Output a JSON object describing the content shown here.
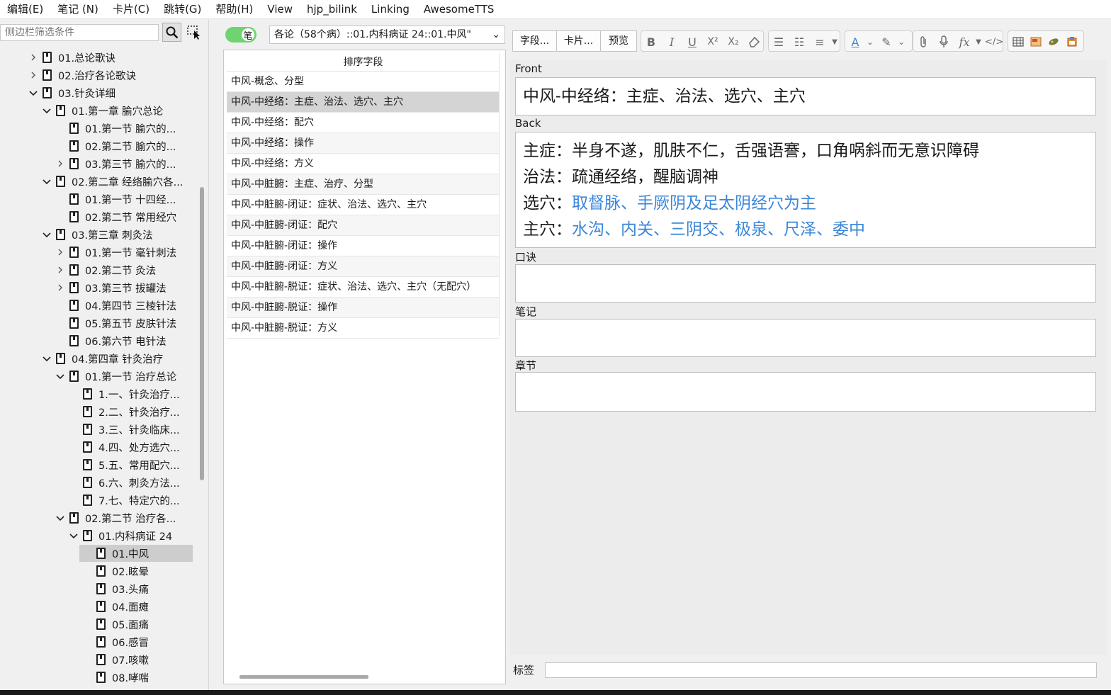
{
  "menu": [
    "编辑(E)",
    "笔记 (N)",
    "卡片(C)",
    "跳转(G)",
    "帮助(H)",
    "View",
    "hjp_bilink",
    "Linking",
    "AwesomeTTS"
  ],
  "sidebar": {
    "search_placeholder": "侧边栏筛选条件",
    "tree": [
      {
        "label": "01.总论歌诀",
        "chevron": "right",
        "level": 0
      },
      {
        "label": "02.治疗各论歌诀",
        "chevron": "right",
        "level": 0
      },
      {
        "label": "03.针灸详细",
        "chevron": "down",
        "level": 0
      },
      {
        "label": "01.第一章 腧穴总论",
        "chevron": "down",
        "level": 1
      },
      {
        "label": "01.第一节 腧穴的...",
        "chevron": "",
        "level": 2
      },
      {
        "label": "02.第二节 腧穴的...",
        "chevron": "",
        "level": 2
      },
      {
        "label": "03.第三节 腧穴的...",
        "chevron": "right",
        "level": 2
      },
      {
        "label": "02.第二章 经络腧穴各...",
        "chevron": "down",
        "level": 1
      },
      {
        "label": "01.第一节 十四经...",
        "chevron": "",
        "level": 2
      },
      {
        "label": "02.第二节 常用经穴",
        "chevron": "",
        "level": 2
      },
      {
        "label": "03.第三章 刺灸法",
        "chevron": "down",
        "level": 1
      },
      {
        "label": "01.第一节 毫针刺法",
        "chevron": "right",
        "level": 2
      },
      {
        "label": "02.第二节 灸法",
        "chevron": "right",
        "level": 2
      },
      {
        "label": "03.第三节 拔罐法",
        "chevron": "right",
        "level": 2
      },
      {
        "label": "04.第四节 三棱针法",
        "chevron": "",
        "level": 2
      },
      {
        "label": "05.第五节 皮肤针法",
        "chevron": "",
        "level": 2
      },
      {
        "label": "06.第六节 电针法",
        "chevron": "",
        "level": 2
      },
      {
        "label": "04.第四章 针灸治疗",
        "chevron": "down",
        "level": 1
      },
      {
        "label": "01.第一节 治疗总论",
        "chevron": "down",
        "level": 2
      },
      {
        "label": "1.一、针灸治疗...",
        "chevron": "",
        "level": 3
      },
      {
        "label": "2.二、针灸治疗...",
        "chevron": "",
        "level": 3
      },
      {
        "label": "3.三、针灸临床...",
        "chevron": "",
        "level": 3
      },
      {
        "label": "4.四、处方选穴...",
        "chevron": "",
        "level": 3
      },
      {
        "label": "5.五、常用配穴...",
        "chevron": "",
        "level": 3
      },
      {
        "label": "6.六、刺灸方法...",
        "chevron": "",
        "level": 3
      },
      {
        "label": "7.七、特定穴的...",
        "chevron": "",
        "level": 3
      },
      {
        "label": "02.第二节 治疗各...",
        "chevron": "down",
        "level": 2
      },
      {
        "label": "01.内科病证 24",
        "chevron": "down",
        "level": 3
      },
      {
        "label": "01.中风",
        "chevron": "",
        "level": 4,
        "selected": true
      },
      {
        "label": "02.眩晕",
        "chevron": "",
        "level": 4
      },
      {
        "label": "03.头痛",
        "chevron": "",
        "level": 4
      },
      {
        "label": "04.面瘫",
        "chevron": "",
        "level": 4
      },
      {
        "label": "05.面痛",
        "chevron": "",
        "level": 4
      },
      {
        "label": "06.感冒",
        "chevron": "",
        "level": 4
      },
      {
        "label": "07.咳嗽",
        "chevron": "",
        "level": 4
      },
      {
        "label": "08.哮喘",
        "chevron": "",
        "level": 4
      }
    ]
  },
  "toggle": {
    "label": "笔",
    "on": true,
    "color": "#6fd46f"
  },
  "deck_select": {
    "value": "各论（58个病）::01.内科病证 24::01.中风\""
  },
  "card_list": {
    "header": "排序字段",
    "rows": [
      "中风-概念、分型",
      "中风-中经络：主症、治法、选穴、主穴",
      "中风-中经络：配穴",
      "中风-中经络：操作",
      "中风-中经络：方义",
      "中风-中脏腑：主症、治疗、分型",
      "中风-中脏腑-闭证：症状、治法、选穴、主穴",
      "中风-中脏腑-闭证：配穴",
      "中风-中脏腑-闭证：操作",
      "中风-中脏腑-闭证：方义",
      "中风-中脏腑-脱证：症状、治法、选穴、主穴（无配穴）",
      "中风-中脏腑-脱证：操作",
      "中风-中脏腑-脱证：方义"
    ],
    "selected_index": 1
  },
  "toolbar": {
    "fields_btn": "字段...",
    "cards_btn": "卡片...",
    "preview_btn": "预览"
  },
  "editor": {
    "fields": [
      {
        "label": "Front"
      },
      {
        "label": "Back"
      },
      {
        "label": "口诀"
      },
      {
        "label": "笔记"
      },
      {
        "label": "章节"
      }
    ],
    "front_text": "中风-中经络：主症、治法、选穴、主穴",
    "back_lines": [
      {
        "prefix": "主症：",
        "text": "半身不遂，肌肤不仁，舌强语謇，口角㖞斜而无意识障碍",
        "blue": false
      },
      {
        "prefix": "治法：",
        "text": "疏通经络，醒脑调神",
        "blue": false
      },
      {
        "prefix": "选穴：",
        "text": "取督脉、手厥阴及足太阴经穴为主",
        "blue": true
      },
      {
        "prefix": "主穴：",
        "text": "水沟、内关、三阴交、极泉、尺泽、委中",
        "blue": true
      }
    ],
    "blue_color": "#3a86d8",
    "tags_label": "标签",
    "tags_value": ""
  }
}
